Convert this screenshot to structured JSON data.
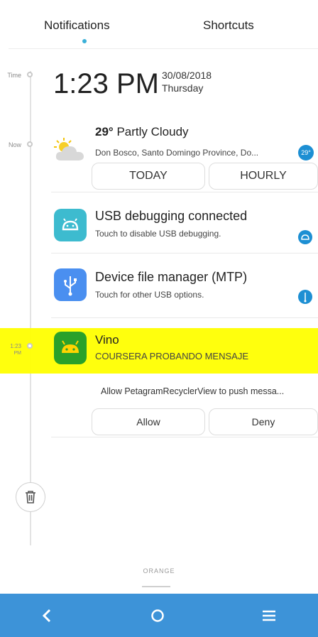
{
  "tabs": {
    "notifications": "Notifications",
    "shortcuts": "Shortcuts"
  },
  "timeline": {
    "time_label": "Time",
    "now_label": "Now",
    "event_time_1": "1:23",
    "event_time_2": "PM"
  },
  "clock": {
    "time": "1:23 PM",
    "date": "30/08/2018",
    "weekday": "Thursday"
  },
  "weather": {
    "temp": "29°",
    "condition": "Partly Cloudy",
    "location": "Don Bosco, Santo Domingo Province, Do...",
    "badge": "29°",
    "today_button": "TODAY",
    "hourly_button": "HOURLY"
  },
  "notifications": [
    {
      "title": "USB debugging connected",
      "subtitle": "Touch to disable USB debugging.",
      "icon": "android-icon",
      "color": "#3dbbcf"
    },
    {
      "title": "Device file manager (MTP)",
      "subtitle": "Touch for other USB options.",
      "icon": "usb-icon",
      "color": "#4a8ff0"
    },
    {
      "title": "Vino",
      "subtitle": "COURSERA PROBANDO MENSAJE",
      "icon": "android-icon",
      "color": "#2aa12a"
    }
  ],
  "permission": {
    "text": "Allow PetagramRecyclerView to push messa...",
    "allow": "Allow",
    "deny": "Deny"
  },
  "footer": {
    "brand": "ORANGE"
  },
  "navbar": {
    "back": "back",
    "home": "home",
    "menu": "menu",
    "color": "#3d93d8"
  },
  "highlight_color": "#ffff00"
}
